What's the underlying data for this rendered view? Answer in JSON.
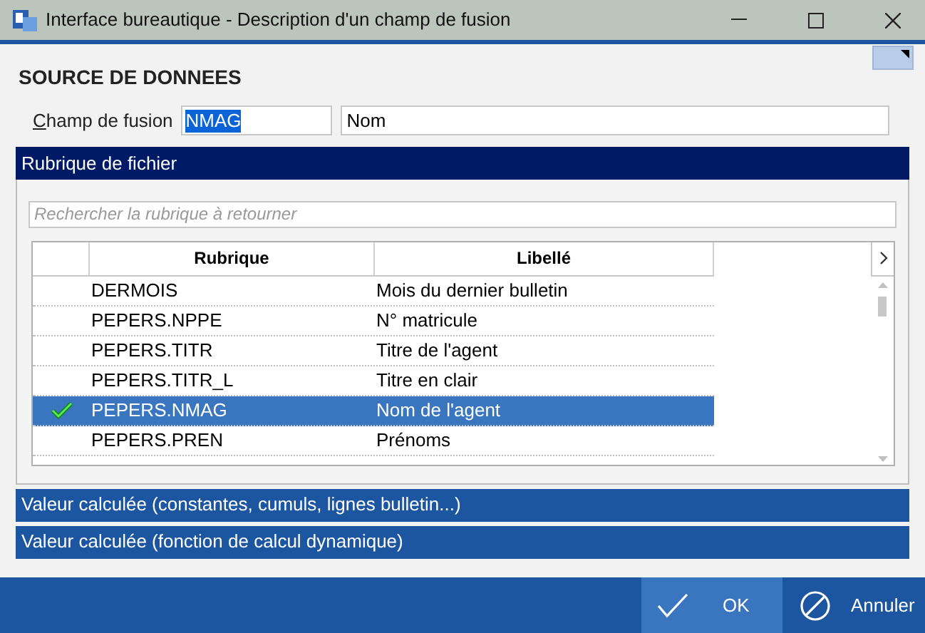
{
  "window": {
    "title": "Interface bureautique - Description d'un champ de fusion"
  },
  "section_title": "SOURCE DE DONNEES",
  "merge_field": {
    "label": "Champ de fusion",
    "value": "NMAG",
    "description": "Nom"
  },
  "panels": [
    {
      "title": "Rubrique de fichier",
      "expanded": true
    },
    {
      "title": "Valeur calculée (constantes, cumuls, lignes bulletin...)",
      "expanded": false
    },
    {
      "title": "Valeur calculée (fonction de calcul dynamique)",
      "expanded": false
    }
  ],
  "search": {
    "placeholder": "Rechercher la rubrique à retourner"
  },
  "table": {
    "columns": [
      "Rubrique",
      "Libellé"
    ],
    "rows": [
      {
        "cells": [
          "DERMOIS",
          "Mois du dernier bulletin"
        ],
        "selected": false
      },
      {
        "cells": [
          "PEPERS.NPPE",
          "N° matricule"
        ],
        "selected": false
      },
      {
        "cells": [
          "PEPERS.TITR",
          "Titre de l'agent"
        ],
        "selected": false
      },
      {
        "cells": [
          "PEPERS.TITR_L",
          "Titre en clair"
        ],
        "selected": false
      },
      {
        "cells": [
          "PEPERS.NMAG",
          "Nom de l'agent"
        ],
        "selected": true
      },
      {
        "cells": [
          "PEPERS.PREN",
          "Prénoms"
        ],
        "selected": false
      }
    ]
  },
  "buttons": [
    {
      "kind": "ok",
      "label": "OK"
    },
    {
      "kind": "cancel",
      "label": "Annuler"
    }
  ]
}
